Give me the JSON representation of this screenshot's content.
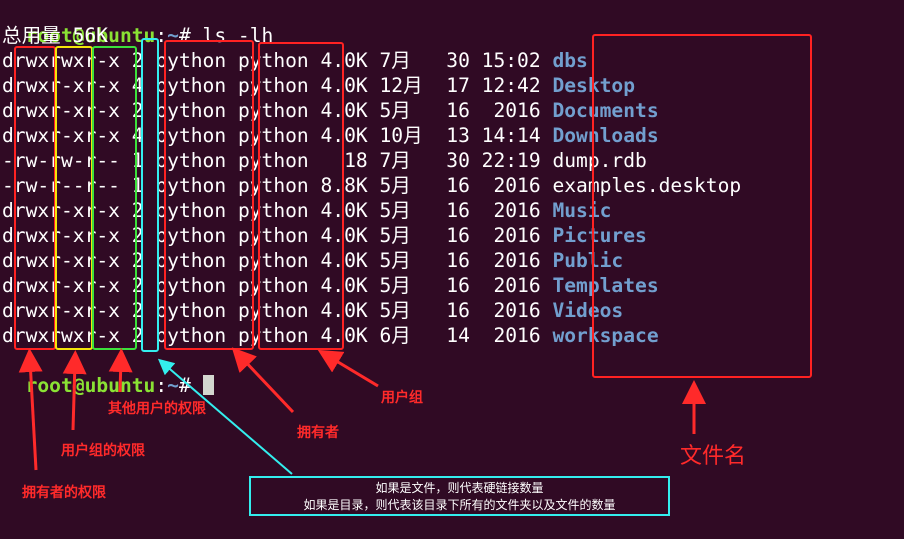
{
  "terminal": {
    "prompt_user": "root@ubuntu",
    "prompt_sep": ":",
    "prompt_path": "~",
    "prompt_symbol": "# ",
    "command": "ls -lh",
    "total_line": "总用量 56K"
  },
  "listing": [
    {
      "perm": "drwxrwxr-x",
      "links": "2",
      "owner": "python",
      "group": "python",
      "size": "4.0K",
      "month": "7月 ",
      "day": " 30",
      "time": "15:02",
      "name": "dbs",
      "kind": "dir"
    },
    {
      "perm": "drwxr-xr-x",
      "links": "4",
      "owner": "python",
      "group": "python",
      "size": "4.0K",
      "month": "12月",
      "day": " 17",
      "time": "12:42",
      "name": "Desktop",
      "kind": "dir"
    },
    {
      "perm": "drwxr-xr-x",
      "links": "2",
      "owner": "python",
      "group": "python",
      "size": "4.0K",
      "month": "5月 ",
      "day": " 16",
      "time": " 2016",
      "name": "Documents",
      "kind": "dir"
    },
    {
      "perm": "drwxr-xr-x",
      "links": "4",
      "owner": "python",
      "group": "python",
      "size": "4.0K",
      "month": "10月",
      "day": " 13",
      "time": "14:14",
      "name": "Downloads",
      "kind": "dir"
    },
    {
      "perm": "-rw-rw-r--",
      "links": "1",
      "owner": "python",
      "group": "python",
      "size": "  18",
      "month": "7月 ",
      "day": " 30",
      "time": "22:19",
      "name": "dump.rdb",
      "kind": "file"
    },
    {
      "perm": "-rw-r--r--",
      "links": "1",
      "owner": "python",
      "group": "python",
      "size": "8.8K",
      "month": "5月 ",
      "day": " 16",
      "time": " 2016",
      "name": "examples.desktop",
      "kind": "file"
    },
    {
      "perm": "drwxr-xr-x",
      "links": "2",
      "owner": "python",
      "group": "python",
      "size": "4.0K",
      "month": "5月 ",
      "day": " 16",
      "time": " 2016",
      "name": "Music",
      "kind": "dir"
    },
    {
      "perm": "drwxr-xr-x",
      "links": "2",
      "owner": "python",
      "group": "python",
      "size": "4.0K",
      "month": "5月 ",
      "day": " 16",
      "time": " 2016",
      "name": "Pictures",
      "kind": "dir"
    },
    {
      "perm": "drwxr-xr-x",
      "links": "2",
      "owner": "python",
      "group": "python",
      "size": "4.0K",
      "month": "5月 ",
      "day": " 16",
      "time": " 2016",
      "name": "Public",
      "kind": "dir"
    },
    {
      "perm": "drwxr-xr-x",
      "links": "2",
      "owner": "python",
      "group": "python",
      "size": "4.0K",
      "month": "5月 ",
      "day": " 16",
      "time": " 2016",
      "name": "Templates",
      "kind": "dir"
    },
    {
      "perm": "drwxr-xr-x",
      "links": "2",
      "owner": "python",
      "group": "python",
      "size": "4.0K",
      "month": "5月 ",
      "day": " 16",
      "time": " 2016",
      "name": "Videos",
      "kind": "dir"
    },
    {
      "perm": "drwxrwxr-x",
      "links": "2",
      "owner": "python",
      "group": "python",
      "size": "4.0K",
      "month": "6月 ",
      "day": " 14",
      "time": " 2016",
      "name": "workspace",
      "kind": "dir"
    }
  ],
  "annotations": {
    "others_perm": "其他用户的权限",
    "group_perm": "用户组的权限",
    "owner_perm": "拥有者的权限",
    "owner": "拥有者",
    "group": "用户组",
    "filename": "文件名",
    "links_note_line1": "如果是文件，则代表硬链接数量",
    "links_note_line2": "如果是目录，则代表该目录下所有的文件夹以及文件的数量"
  },
  "colors": {
    "background": "#300a24",
    "prompt_user": "#8ae234",
    "directory": "#729fcf",
    "annotation_red": "#ff2a2a",
    "annotation_yellow": "#f5e50a",
    "annotation_green": "#3ce03c",
    "annotation_cyan": "#33eeee"
  }
}
